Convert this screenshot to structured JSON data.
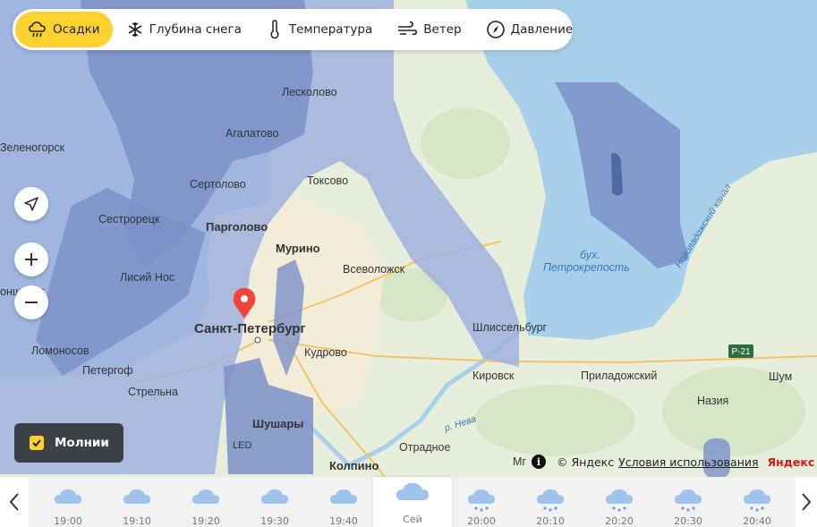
{
  "tabs": [
    {
      "label": "Осадки",
      "icon": "rain-cloud-icon",
      "active": true
    },
    {
      "label": "Глубина снега",
      "icon": "snowflake-icon",
      "active": false
    },
    {
      "label": "Температура",
      "icon": "thermometer-icon",
      "active": false
    },
    {
      "label": "Ветер",
      "icon": "wind-icon",
      "active": false
    },
    {
      "label": "Давление",
      "icon": "compass-icon",
      "active": false
    }
  ],
  "map": {
    "labels": {
      "leskolovo": "Лесколово",
      "agalatovo": "Агалатово",
      "zelenogorsk": "Зеленогорск",
      "sertolovo": "Сертолово",
      "toksovo": "Токсово",
      "sestroretsk": "Сестрорецк",
      "pargolovo": "Парголово",
      "murino": "Мурино",
      "vsevolozhsk": "Всеволожск",
      "lisiy_nos": "Лисий Нос",
      "kronshtadt": "онштадт",
      "spb": "Санкт-Петербург",
      "lomonosov": "Ломоносов",
      "kudrovo": "Кудрово",
      "petergof": "Петергоф",
      "strelna": "Стрельна",
      "shushary": "Шушары",
      "led": "LED",
      "otradnoe": "Отрадное",
      "kolpino": "Колпино",
      "kirovsk": "Кировск",
      "shlisselburg": "Шлиссельбург",
      "bay": "бух.",
      "bay2": "Петрокрепость",
      "priladozhsky": "Приладожский",
      "nazia": "Назия",
      "shum": "Шум",
      "r21": "Р-21",
      "canal": "Новоладожский канал",
      "mga": "Мг",
      "neva": "р. Нева"
    }
  },
  "controls": {
    "locate": "locate-icon",
    "zoom_in": "+",
    "zoom_out": "−"
  },
  "lightning": {
    "label": "Молнии",
    "checked": true
  },
  "attribution": {
    "copyright": "© Яндекс",
    "terms": "Условия использования",
    "brand": "Яндекс"
  },
  "timeline": {
    "slots": [
      {
        "time": "19:00",
        "icon": "cloud-icon"
      },
      {
        "time": "19:10",
        "icon": "cloud-icon"
      },
      {
        "time": "19:20",
        "icon": "cloud-icon"
      },
      {
        "time": "19:30",
        "icon": "cloud-icon"
      },
      {
        "time": "19:40",
        "icon": "cloud-icon"
      },
      {
        "time": "Сей",
        "icon": "cloud-icon",
        "active": true
      },
      {
        "time": "20:00",
        "icon": "rain-cloud-icon"
      },
      {
        "time": "20:10",
        "icon": "rain-cloud-icon"
      },
      {
        "time": "20:20",
        "icon": "rain-cloud-icon"
      },
      {
        "time": "20:30",
        "icon": "rain-cloud-icon"
      },
      {
        "time": "20:40",
        "icon": "rain-cloud-icon"
      }
    ]
  },
  "colors": {
    "accent": "#fcd22f",
    "precip_light": "#9fb1dd",
    "precip_mid": "#7b91c8",
    "precip_dark": "#4f6aa5",
    "water": "#a8d0ea",
    "land": "#e7eedc",
    "marker": "#f2433a"
  }
}
